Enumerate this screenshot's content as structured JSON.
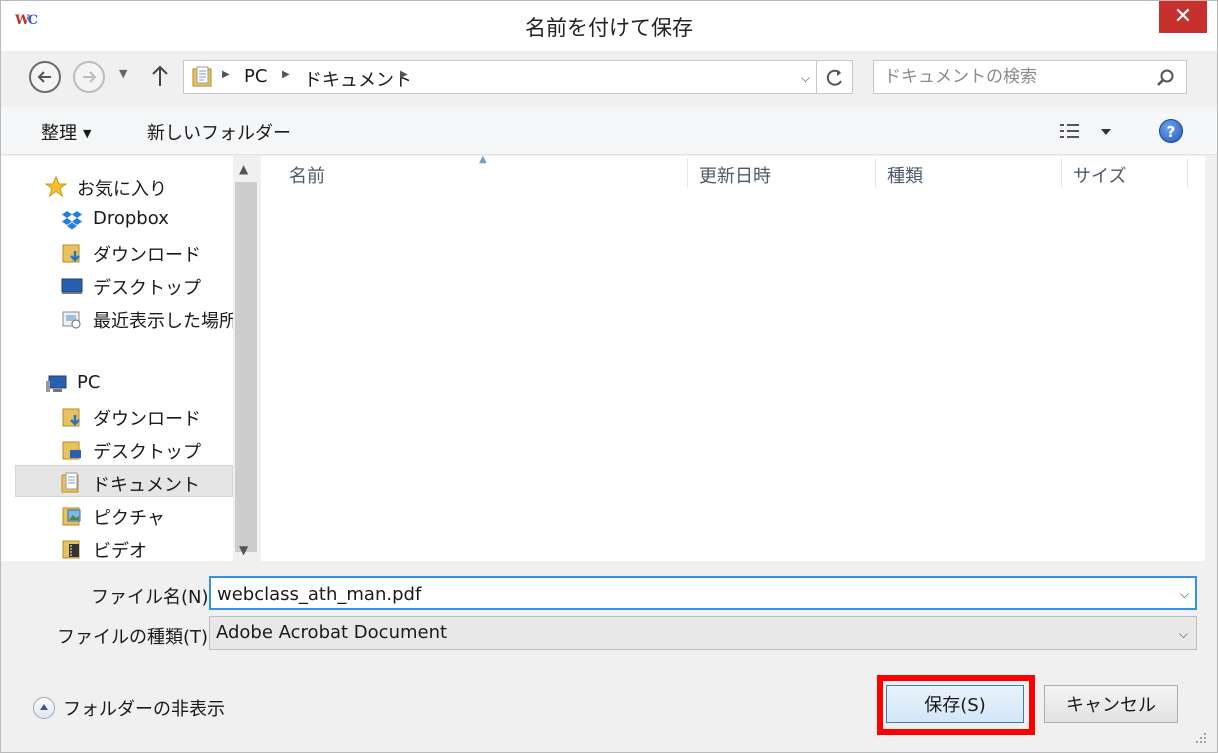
{
  "window": {
    "title": "名前を付けて保存",
    "app_icon_text": [
      "W",
      "C"
    ],
    "close_glyph": "✕"
  },
  "address": {
    "crumbs": [
      "PC",
      "ドキュメント"
    ],
    "search_placeholder": "ドキュメントの検索"
  },
  "toolbar": {
    "organize_label": "整理",
    "new_folder_label": "新しいフォルダー",
    "help_glyph": "?"
  },
  "navigation": {
    "favorites": {
      "label": "お気に入り",
      "items": [
        "Dropbox",
        "ダウンロード",
        "デスクトップ",
        "最近表示した場所"
      ]
    },
    "pc": {
      "label": "PC",
      "items": [
        "ダウンロード",
        "デスクトップ",
        "ドキュメント",
        "ピクチャ",
        "ビデオ"
      ]
    },
    "selected": "ドキュメント"
  },
  "file_list": {
    "columns": [
      "名前",
      "更新日時",
      "種類",
      "サイズ"
    ],
    "rows": []
  },
  "form": {
    "filename_label": "ファイル名(N):",
    "filename_value": "webclass_ath_man.pdf",
    "filetype_label": "ファイルの種類(T):",
    "filetype_value": "Adobe Acrobat Document"
  },
  "footer": {
    "hide_folders_label": "フォルダーの非表示",
    "save_label": "保存(S)",
    "cancel_label": "キャンセル"
  },
  "colors": {
    "highlight": "#ff0000",
    "close_button": "#c7302d",
    "focus_border": "#3a8ee6"
  }
}
